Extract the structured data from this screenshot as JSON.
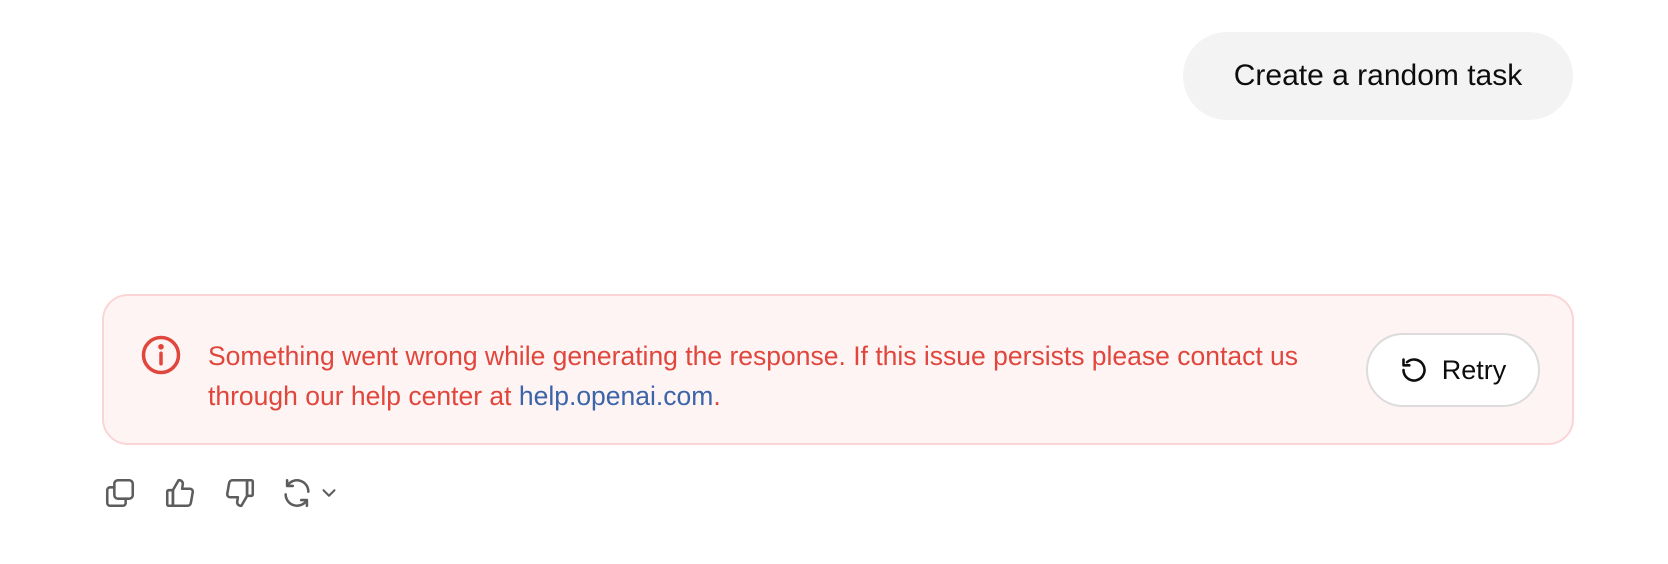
{
  "user_message": {
    "text": "Create a random task"
  },
  "error": {
    "message": "Something went wrong while generating the response. If this issue persists please contact us through our help center at ",
    "link_text": "help.openai.com",
    "trailing": ".",
    "icon": "info-circle-icon",
    "color": "#e0463c",
    "link_color": "#3c64a8",
    "background": "#fef4f4"
  },
  "retry_button": {
    "label": "Retry",
    "icon": "rotate-ccw-icon"
  },
  "actions": [
    {
      "name": "copy",
      "icon": "copy-icon"
    },
    {
      "name": "thumbs-up",
      "icon": "thumbs-up-icon"
    },
    {
      "name": "thumbs-down",
      "icon": "thumbs-down-icon"
    },
    {
      "name": "regenerate",
      "icon": "refresh-icon"
    }
  ]
}
